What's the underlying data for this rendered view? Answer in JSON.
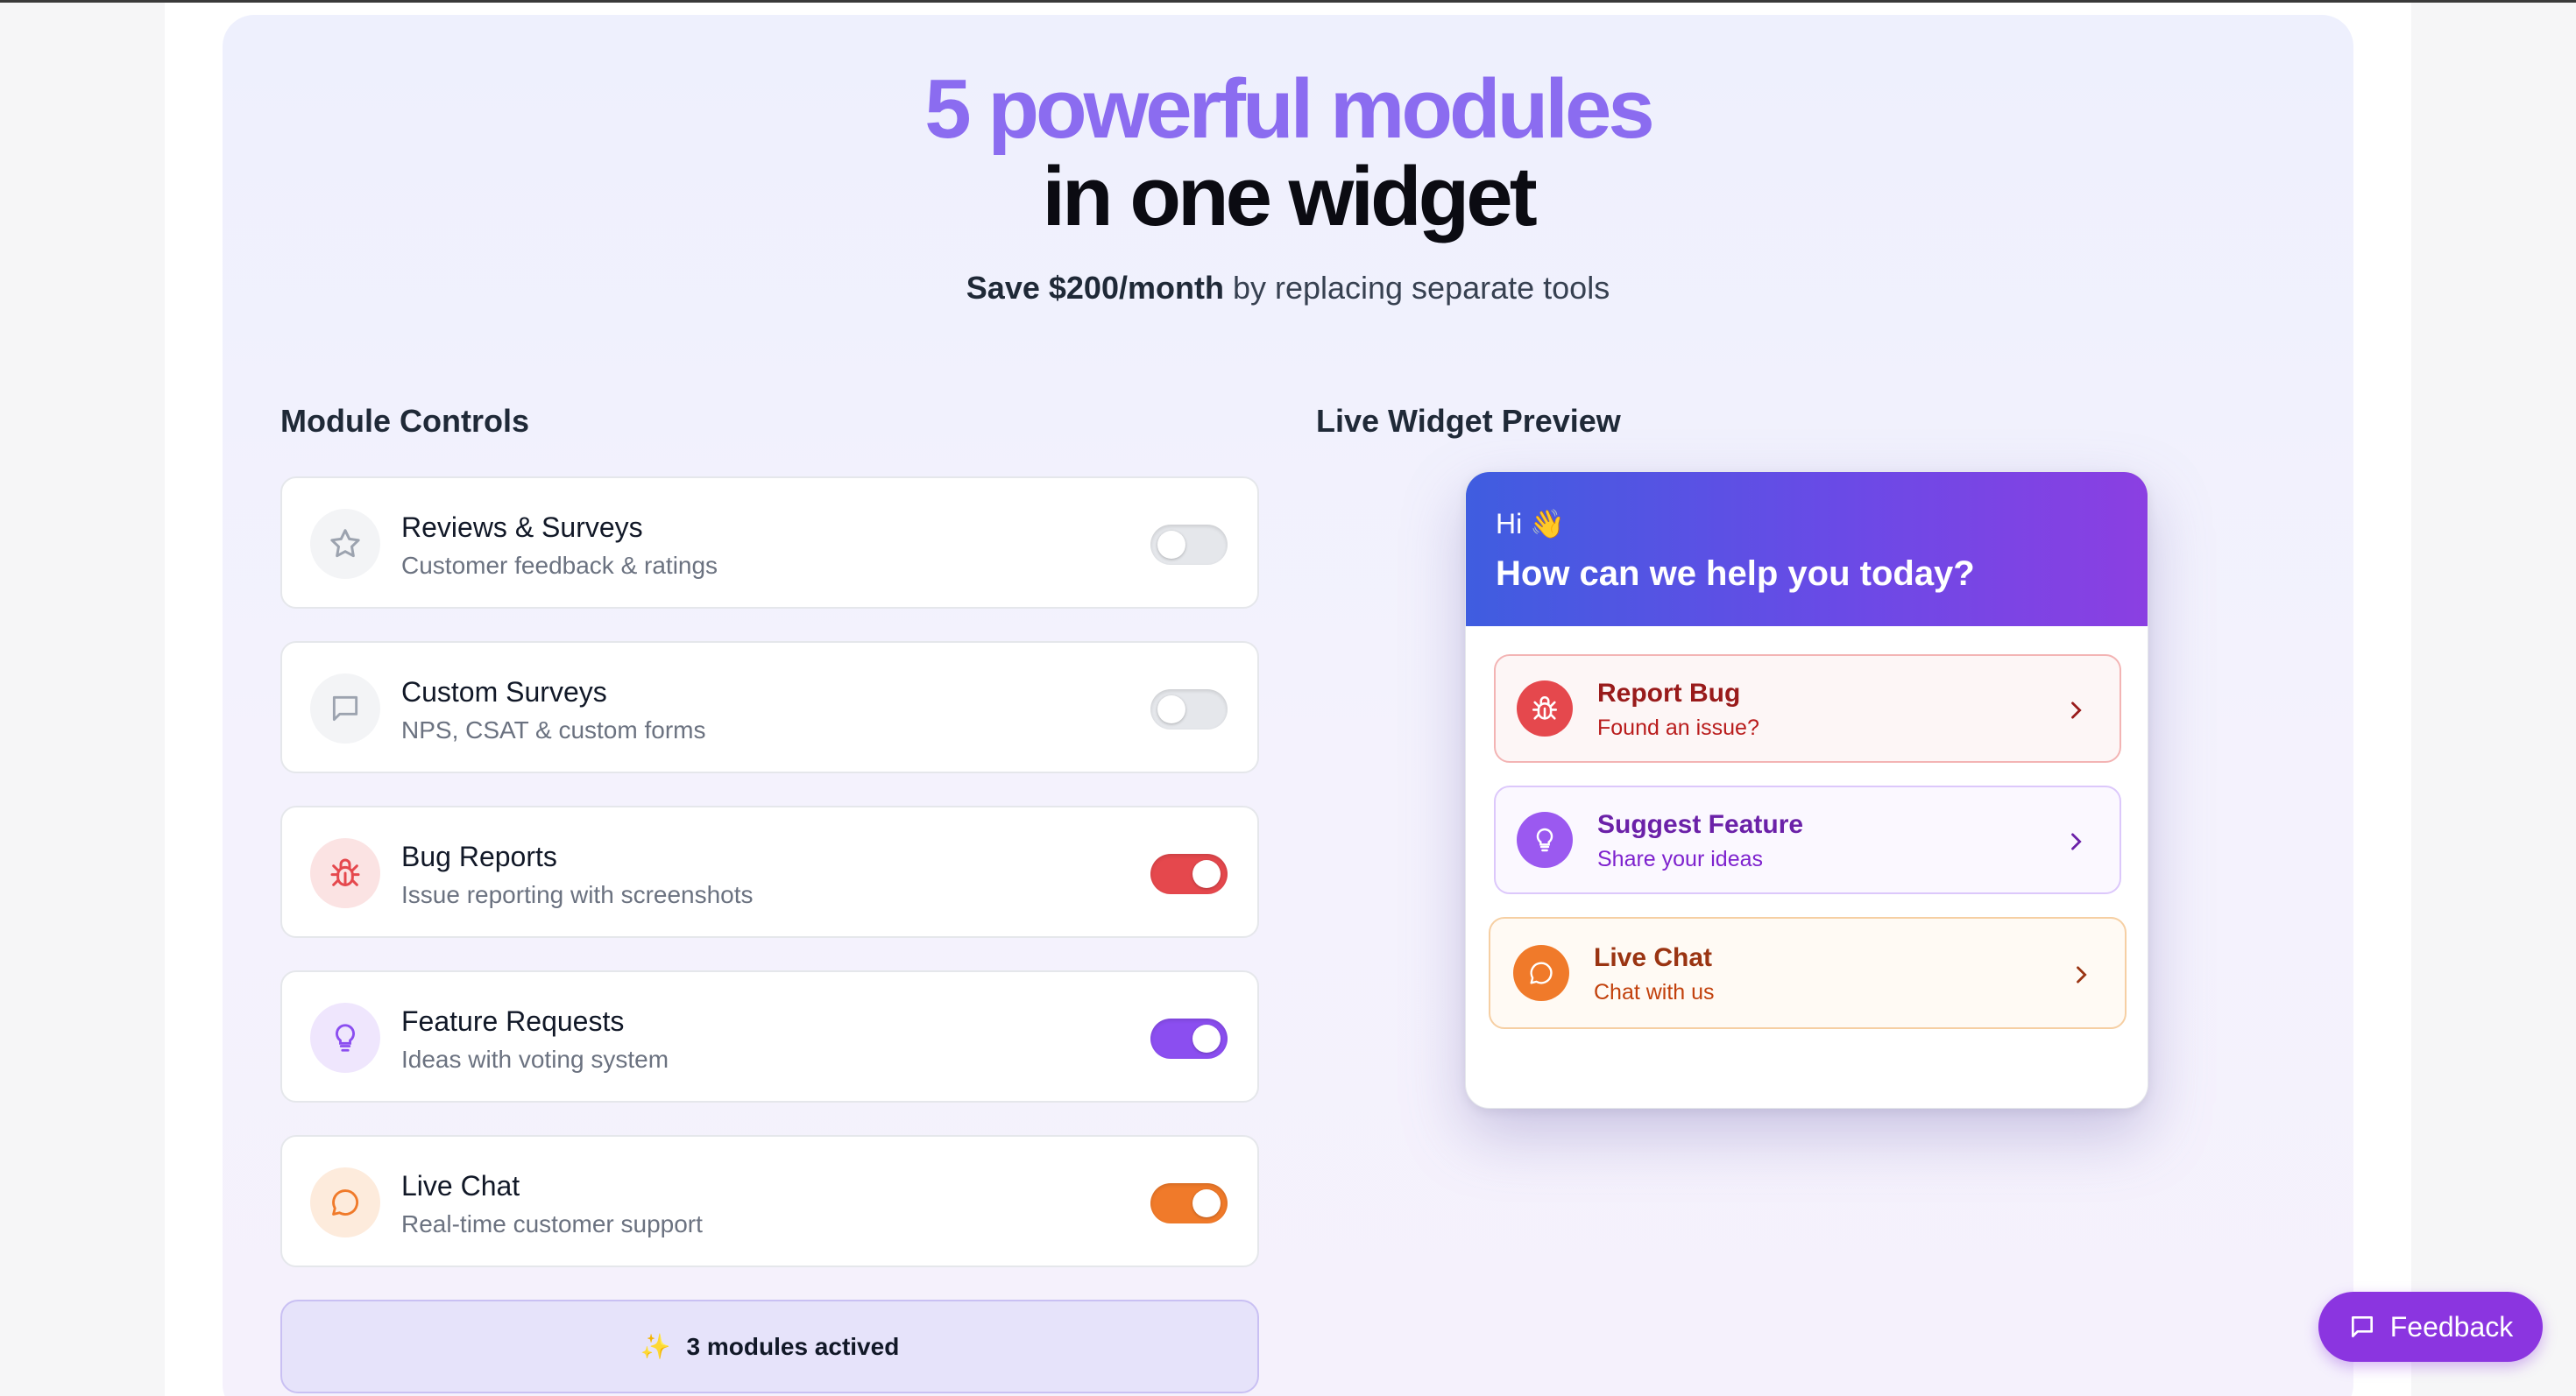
{
  "hero": {
    "title_line1": "5 powerful modules",
    "title_line2": "in one widget",
    "subtitle_bold": "Save $200/month",
    "subtitle_rest": " by replacing separate tools"
  },
  "controls": {
    "heading": "Module Controls",
    "modules": [
      {
        "title": "Reviews & Surveys",
        "desc": "Customer feedback & ratings",
        "icon": "star-icon",
        "enabled": false,
        "color": "#9ca3af"
      },
      {
        "title": "Custom Surveys",
        "desc": "NPS, CSAT & custom forms",
        "icon": "message-square-icon",
        "enabled": false,
        "color": "#9ca3af"
      },
      {
        "title": "Bug Reports",
        "desc": "Issue reporting with screenshots",
        "icon": "bug-icon",
        "enabled": true,
        "color": "#e5484d"
      },
      {
        "title": "Feature Requests",
        "desc": "Ideas with voting system",
        "icon": "lightbulb-icon",
        "enabled": true,
        "color": "#8b4ef0"
      },
      {
        "title": "Live Chat",
        "desc": "Real-time customer support",
        "icon": "chat-bubble-icon",
        "enabled": true,
        "color": "#f07a2a"
      }
    ],
    "summary_icon": "✨",
    "summary": "3 modules actived"
  },
  "preview": {
    "heading": "Live Widget Preview",
    "greeting": "Hi 👋",
    "question": "How can we help you today?",
    "options": [
      {
        "title": "Report Bug",
        "subtitle": "Found an issue?",
        "icon": "bug-icon"
      },
      {
        "title": "Suggest Feature",
        "subtitle": "Share your ideas",
        "icon": "lightbulb-icon"
      },
      {
        "title": "Live Chat",
        "subtitle": "Chat with us",
        "icon": "chat-bubble-icon"
      }
    ]
  },
  "feedback_button": {
    "label": "Feedback",
    "icon": "message-square-icon"
  },
  "colors": {
    "accent_purple": "#8b6cf0",
    "bug_red": "#e5484d",
    "feature_purple": "#8b4ef0",
    "chat_orange": "#f07a2a",
    "feedback_button": "#8b35e0"
  }
}
